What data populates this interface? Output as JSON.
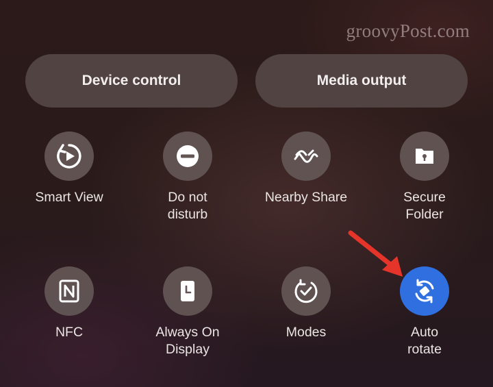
{
  "watermark": "groovyPost.com",
  "top_buttons": {
    "device_control": "Device control",
    "media_output": "Media output"
  },
  "tiles": [
    {
      "label": "Smart View",
      "icon": "smart-view-icon",
      "active": false
    },
    {
      "label": "Do not\ndisturb",
      "icon": "do-not-disturb-icon",
      "active": false
    },
    {
      "label": "Nearby Share",
      "icon": "nearby-share-icon",
      "active": false
    },
    {
      "label": "Secure\nFolder",
      "icon": "secure-folder-icon",
      "active": false
    },
    {
      "label": "NFC",
      "icon": "nfc-icon",
      "active": false
    },
    {
      "label": "Always On\nDisplay",
      "icon": "always-on-display-icon",
      "active": false
    },
    {
      "label": "Modes",
      "icon": "modes-icon",
      "active": false
    },
    {
      "label": "Auto\nrotate",
      "icon": "auto-rotate-icon",
      "active": true
    }
  ],
  "colors": {
    "active_tile": "#2f6fe0",
    "inactive_tile": "#625554",
    "annotation_arrow": "#e5352a"
  }
}
